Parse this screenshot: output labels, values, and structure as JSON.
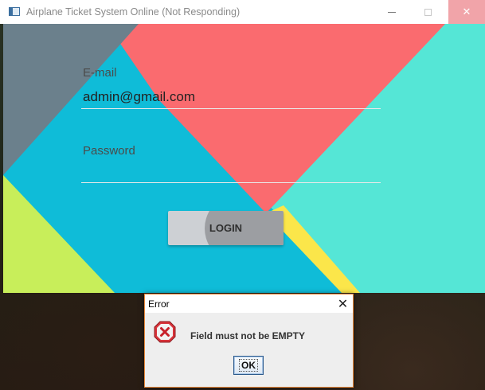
{
  "window": {
    "title": "Airplane Ticket System Online (Not Responding)",
    "icons": {
      "app": "app-window-icon",
      "minimize": "minimize-icon",
      "maximize": "maximize-icon",
      "close": "close-icon"
    },
    "close_glyph": "✕"
  },
  "login_form": {
    "email_label": "E-mail",
    "email_value": "admin@gmail.com",
    "password_label": "Password",
    "password_value": "",
    "login_button_label": "LOGIN"
  },
  "error_dialog": {
    "title": "Error",
    "close_glyph": "✕",
    "message": "Field must not be EMPTY",
    "ok_label": "OK",
    "icon": "error-x-icon"
  },
  "colors": {
    "slate": "#6b808c",
    "cyan": "#0fbcd8",
    "coral": "#fa6b6f",
    "teal": "#55e6d6",
    "lime": "#c8ee5a",
    "yellow": "#fbe64a",
    "dialog_border": "#e8883a",
    "error_red": "#d8333a"
  }
}
